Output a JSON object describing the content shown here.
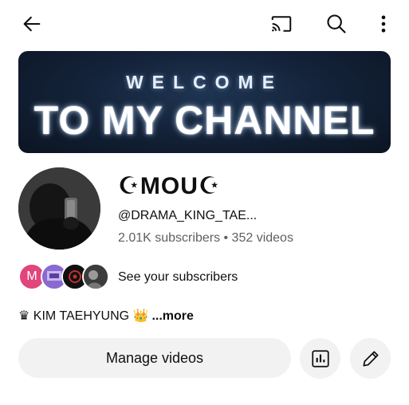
{
  "icons": {
    "back": "arrow-left-icon",
    "cast": "cast-icon",
    "search": "search-icon",
    "more": "more-vert-icon",
    "analytics": "analytics-icon",
    "edit": "pencil-icon"
  },
  "banner": {
    "line1": "WELCOME",
    "line2": "TO MY CHANNEL"
  },
  "channel": {
    "name": "☪MOU☪",
    "handle": "@DRAMA_KING_TAE...",
    "stats": "2.01K subscribers • 352 videos"
  },
  "subscribers": {
    "first_initial": "M",
    "label": "See your subscribers"
  },
  "description": {
    "crown": "♛",
    "text": " KIM TAEHYUNG 👑",
    "more": "...more"
  },
  "actions": {
    "manage_label": "Manage videos"
  },
  "colors": {
    "banner_bg": "#14233a",
    "button_bg": "#f2f2f2",
    "secondary_text": "#606060",
    "avatar_m": "#e0457b"
  }
}
